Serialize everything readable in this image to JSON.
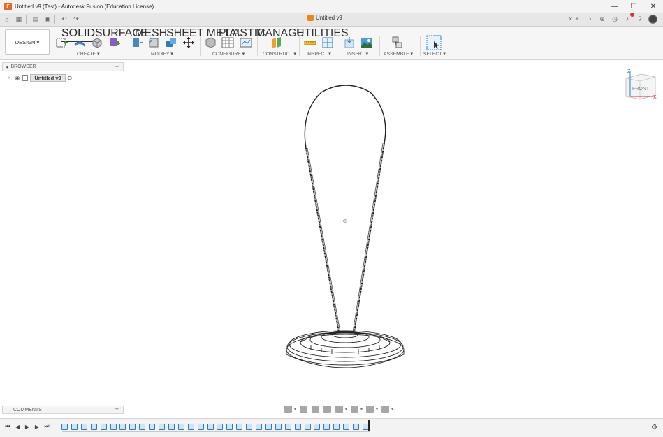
{
  "titlebar": {
    "title": "Untitled v9 (Test) - Autodesk Fusion (Education License)",
    "minimize": "—",
    "maximize": "☐",
    "close": "✕"
  },
  "document_tab": {
    "name": "Untitled v9",
    "close": "×"
  },
  "workspace": {
    "label": "DESIGN ▾"
  },
  "tabs": [
    {
      "label": "SOLID",
      "active": true
    },
    {
      "label": "SURFACE",
      "active": false
    },
    {
      "label": "MESH",
      "active": false
    },
    {
      "label": "SHEET METAL",
      "active": false
    },
    {
      "label": "PLASTIC",
      "active": false
    },
    {
      "label": "MANAGE",
      "active": false
    },
    {
      "label": "UTILITIES",
      "active": false
    }
  ],
  "groups": [
    {
      "label": "CREATE ▾"
    },
    {
      "label": "MODIFY ▾"
    },
    {
      "label": "CONFIGURE ▾"
    },
    {
      "label": "CONSTRUCT ▾"
    },
    {
      "label": "INSPECT ▾"
    },
    {
      "label": "INSERT ▾"
    },
    {
      "label": "ASSEMBLE ▾"
    },
    {
      "label": "SELECT ▾"
    }
  ],
  "browser": {
    "title": "BROWSER",
    "collapse": "−",
    "root": "Untitled v9"
  },
  "comments": {
    "title": "COMMENTS",
    "add": "+"
  },
  "viewcube": {
    "face": "FRONT",
    "z_axis": "Z",
    "x_axis": "X"
  },
  "colors": {
    "accent_blue": "#2d7bc4",
    "fusion_orange": "#e8681c"
  },
  "icons": {
    "home": "home-icon",
    "grid": "app-grid-icon",
    "file": "file-icon",
    "save": "save-icon",
    "undo": "undo-icon",
    "redo": "redo-icon",
    "gear": "settings-gear-icon"
  }
}
